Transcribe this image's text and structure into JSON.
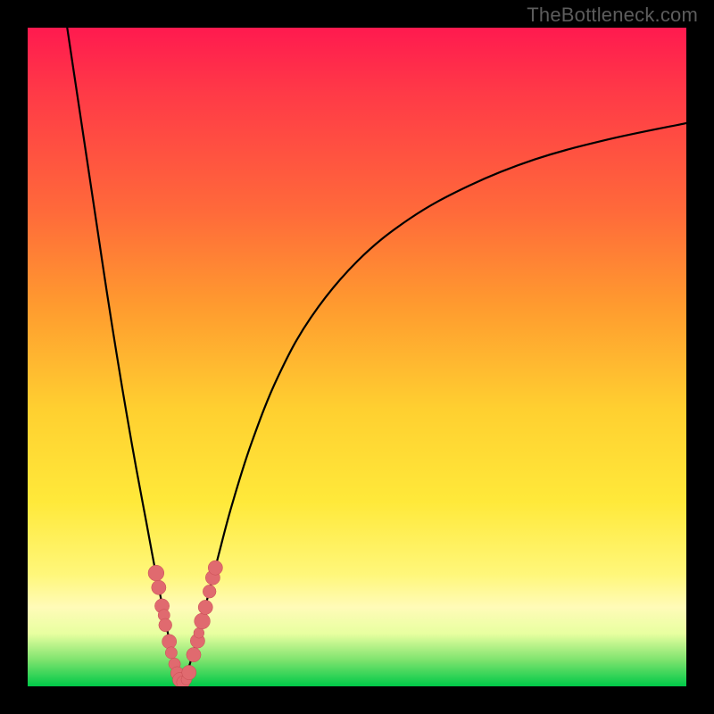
{
  "watermark": "TheBottleneck.com",
  "colors": {
    "frame": "#000000",
    "curve": "#000000",
    "dot_fill": "#e06a6f",
    "dot_stroke": "#c74b52",
    "gradient_stops": [
      "#ff1a4f",
      "#ff3a47",
      "#ff6a3a",
      "#ff9a2f",
      "#ffd030",
      "#ffe93a",
      "#fff77a",
      "#fffbb8",
      "#e8ffa0",
      "#7ee36e",
      "#00c948"
    ]
  },
  "chart_data": {
    "type": "line",
    "title": "",
    "xlabel": "",
    "ylabel": "",
    "xlim": [
      0,
      100
    ],
    "ylim": [
      0,
      100
    ],
    "grid": false,
    "legend": false,
    "notes": "Axes unlabeled in image. x expressed as % across plot width, y as % height (0 = bottom, 100 = top). Values estimated from pixels.",
    "series": [
      {
        "name": "left-branch",
        "x": [
          6.0,
          7.5,
          9.0,
          10.5,
          12.0,
          13.5,
          15.0,
          16.5,
          18.0,
          19.3,
          20.5,
          21.4,
          22.0,
          22.6,
          23.1
        ],
        "y": [
          100.0,
          90.0,
          80.0,
          70.0,
          60.0,
          50.5,
          41.5,
          33.0,
          25.0,
          18.0,
          12.0,
          7.5,
          4.5,
          2.0,
          0.5
        ]
      },
      {
        "name": "right-branch",
        "x": [
          23.6,
          24.5,
          25.8,
          27.2,
          29.0,
          31.0,
          34.0,
          38.0,
          43.0,
          50.0,
          58.0,
          67.0,
          77.0,
          88.0,
          100.0
        ],
        "y": [
          0.5,
          3.0,
          7.5,
          13.0,
          20.0,
          27.5,
          37.0,
          47.0,
          56.0,
          64.5,
          71.0,
          76.0,
          80.0,
          83.0,
          85.5
        ]
      }
    ],
    "scatter": {
      "name": "sample-dots",
      "points": [
        {
          "x": 19.5,
          "y": 17.2,
          "r": 1.2
        },
        {
          "x": 19.9,
          "y": 15.0,
          "r": 1.1
        },
        {
          "x": 20.4,
          "y": 12.2,
          "r": 1.1
        },
        {
          "x": 20.7,
          "y": 10.8,
          "r": 0.9
        },
        {
          "x": 20.9,
          "y": 9.3,
          "r": 1.0
        },
        {
          "x": 21.5,
          "y": 6.8,
          "r": 1.1
        },
        {
          "x": 21.8,
          "y": 5.1,
          "r": 0.9
        },
        {
          "x": 22.3,
          "y": 3.4,
          "r": 0.9
        },
        {
          "x": 22.7,
          "y": 2.0,
          "r": 1.0
        },
        {
          "x": 23.1,
          "y": 1.0,
          "r": 1.1
        },
        {
          "x": 23.6,
          "y": 0.6,
          "r": 1.0
        },
        {
          "x": 24.1,
          "y": 1.0,
          "r": 0.8
        },
        {
          "x": 24.5,
          "y": 2.1,
          "r": 1.1
        },
        {
          "x": 25.2,
          "y": 4.8,
          "r": 1.1
        },
        {
          "x": 25.8,
          "y": 6.9,
          "r": 1.1
        },
        {
          "x": 26.0,
          "y": 8.1,
          "r": 0.8
        },
        {
          "x": 26.5,
          "y": 9.9,
          "r": 1.2
        },
        {
          "x": 27.0,
          "y": 12.0,
          "r": 1.1
        },
        {
          "x": 27.6,
          "y": 14.4,
          "r": 1.0
        },
        {
          "x": 28.1,
          "y": 16.5,
          "r": 1.1
        },
        {
          "x": 28.5,
          "y": 18.0,
          "r": 1.1
        }
      ]
    }
  }
}
